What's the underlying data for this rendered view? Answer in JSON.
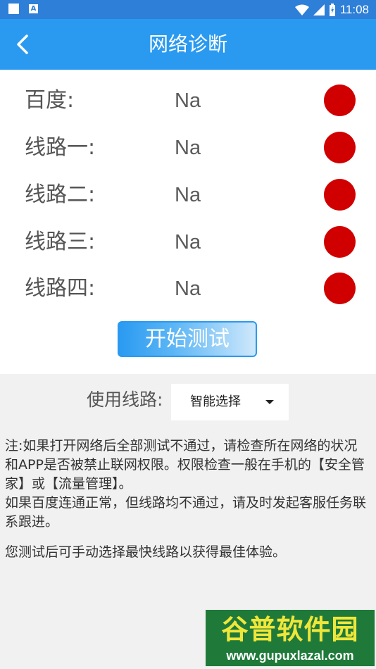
{
  "status_bar": {
    "left_icon_b_text": "A",
    "time": "11:08"
  },
  "app_bar": {
    "title": "网络诊断"
  },
  "checks": [
    {
      "label": "百度:",
      "value": "Na",
      "status_color": "#d10000"
    },
    {
      "label": "线路一:",
      "value": "Na",
      "status_color": "#d10000"
    },
    {
      "label": "线路二:",
      "value": "Na",
      "status_color": "#d10000"
    },
    {
      "label": "线路三:",
      "value": "Na",
      "status_color": "#d10000"
    },
    {
      "label": "线路四:",
      "value": "Na",
      "status_color": "#d10000"
    }
  ],
  "start_button": {
    "label": "开始测试"
  },
  "route": {
    "label": "使用线路:",
    "selected": "智能选择"
  },
  "notes": {
    "p1": "注:如果打开网络后全部测试不通过，请检查所在网络的状况和APP是否被禁止联网权限。权限检查一般在手机的【安全管家】或【流量管理】。",
    "p2": "如果百度连通正常，但线路均不通过，请及时发起客服任务联系跟进。",
    "p3": "您测试后可手动选择最快线路以获得最佳体验。"
  },
  "watermark": {
    "name": "谷普软件园",
    "url": "www.gupuxlazal.com"
  },
  "colors": {
    "status_bar": "#2d7fd8",
    "app_bar": "#2a9af1",
    "status_dot": "#d10000"
  }
}
